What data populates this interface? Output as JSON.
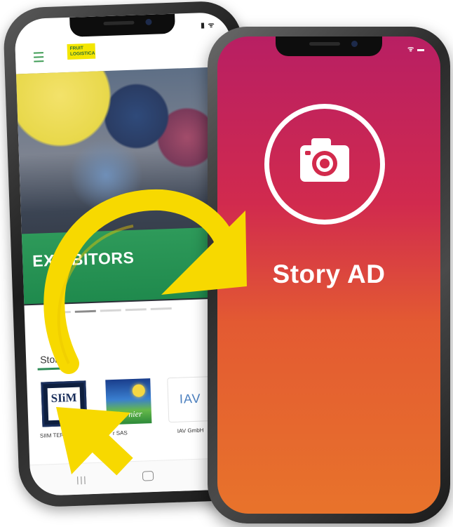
{
  "back_phone": {
    "status": "███ •",
    "logo_text": "FRUIT LOGISTICA",
    "hero_title": "EXHIBITORS",
    "stories_label": "Stories",
    "stories": [
      {
        "logo": "SIiM",
        "name": "SIIM TERRA"
      },
      {
        "logo": "Barnier",
        "name": "r SAS"
      },
      {
        "logo": "IAV",
        "name": "IAV GmbH"
      }
    ],
    "nav_recent": "|||"
  },
  "front_phone": {
    "title": "Story AD",
    "status": "••• ▮"
  },
  "colors": {
    "brand_green": "#2e9a5a",
    "logo_yellow": "#f3e600",
    "ad_gradient_top": "#b81f63",
    "ad_gradient_bottom": "#e8732b",
    "arrow_yellow": "#f7d900"
  },
  "icons": [
    "hamburger-icon",
    "camera-icon",
    "curved-arrow-icon",
    "pointer-arrow-icon"
  ]
}
